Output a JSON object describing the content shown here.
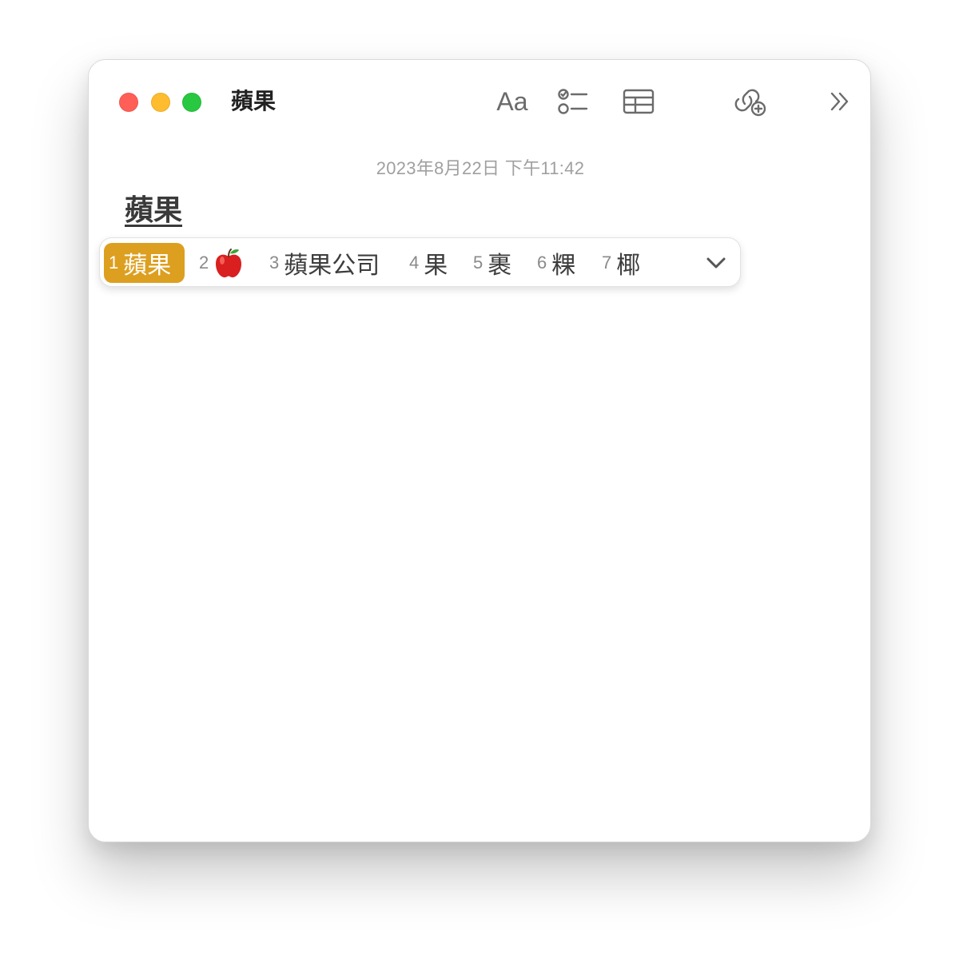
{
  "window": {
    "title": "蘋果"
  },
  "toolbar": {
    "format_label": "Aa",
    "format_icon": "text-format-icon",
    "checklist_icon": "checklist-icon",
    "table_icon": "table-icon",
    "collaborate_icon": "collaborate-add-icon",
    "more_icon": "chevron-double-right-icon"
  },
  "note": {
    "date": "2023年8月22日 下午11:42",
    "text": "蘋果"
  },
  "candidates": {
    "selected_color": "#dd9f1f",
    "items": [
      {
        "num": "1",
        "word": "蘋果"
      },
      {
        "num": "2",
        "word": "🍎"
      },
      {
        "num": "3",
        "word": "蘋果公司"
      },
      {
        "num": "4",
        "word": "果"
      },
      {
        "num": "5",
        "word": "裹"
      },
      {
        "num": "6",
        "word": "粿"
      },
      {
        "num": "7",
        "word": "椰"
      }
    ],
    "expand_icon": "chevron-down-icon"
  },
  "colors": {
    "close": "#ff5f57",
    "minimize": "#febc2e",
    "zoom": "#28c840"
  }
}
